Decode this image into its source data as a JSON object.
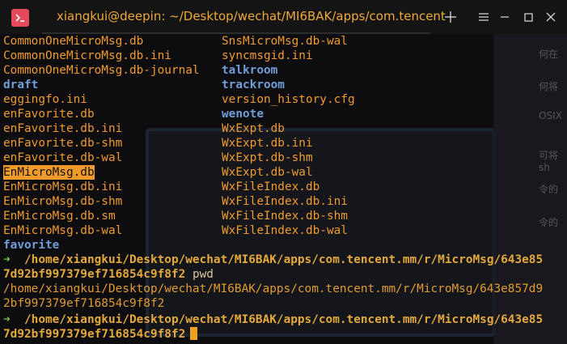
{
  "window": {
    "tab_title": "xiangkui@deepin: ~/Desktop/wechat/MI6BAK/apps/com.tencent"
  },
  "colors": {
    "file": "#f09a2c",
    "directory": "#6f9ed8",
    "prompt_arrow": "#7fbf4a",
    "app_icon": "#e54a5b"
  },
  "listing": {
    "col1": [
      {
        "name": "CommonOneMicroMsg.db",
        "type": "file"
      },
      {
        "name": "CommonOneMicroMsg.db.ini",
        "type": "file"
      },
      {
        "name": "CommonOneMicroMsg.db-journal",
        "type": "file"
      },
      {
        "name": "draft",
        "type": "dir"
      },
      {
        "name": "eggingfo.ini",
        "type": "file"
      },
      {
        "name": "enFavorite.db",
        "type": "file"
      },
      {
        "name": "enFavorite.db.ini",
        "type": "file"
      },
      {
        "name": "enFavorite.db-shm",
        "type": "file"
      },
      {
        "name": "enFavorite.db-wal",
        "type": "file"
      },
      {
        "name": "EnMicroMsg.db",
        "type": "file-highlight"
      },
      {
        "name": "EnMicroMsg.db.ini",
        "type": "file"
      },
      {
        "name": "EnMicroMsg.db-shm",
        "type": "file"
      },
      {
        "name": "EnMicroMsg.db.sm",
        "type": "file"
      },
      {
        "name": "EnMicroMsg.db-wal",
        "type": "file"
      },
      {
        "name": "favorite",
        "type": "dir"
      }
    ],
    "col2": [
      {
        "name": "SnsMicroMsg.db-wal",
        "type": "file"
      },
      {
        "name": "syncmsgid.ini",
        "type": "file"
      },
      {
        "name": "talkroom",
        "type": "dir"
      },
      {
        "name": "trackroom",
        "type": "dir"
      },
      {
        "name": "version_history.cfg",
        "type": "file"
      },
      {
        "name": "wenote",
        "type": "dir"
      },
      {
        "name": "WxExpt.db",
        "type": "file"
      },
      {
        "name": "WxExpt.db.ini",
        "type": "file"
      },
      {
        "name": "WxExpt.db-shm",
        "type": "file"
      },
      {
        "name": "WxExpt.db-wal",
        "type": "file"
      },
      {
        "name": "WxFileIndex.db",
        "type": "file"
      },
      {
        "name": "WxFileIndex.db.ini",
        "type": "file"
      },
      {
        "name": "WxFileIndex.db-shm",
        "type": "file"
      },
      {
        "name": "WxFileIndex.db-wal",
        "type": "file"
      }
    ]
  },
  "session": {
    "prompt_arrow": "➜",
    "prompt1_path_a": "/home/xiangkui/Desktop/wechat/MI6BAK/apps/com.tencent.mm/r/MicroMsg/643e85",
    "prompt1_path_b": "7d92bf997379ef716854c9f8f2",
    "prompt1_cmd": "pwd",
    "output_a": "/home/xiangkui/Desktop/wechat/MI6BAK/apps/com.tencent.mm/r/MicroMsg/643e857d9",
    "output_b": "2bf997379ef716854c9f8f2",
    "prompt2_path_a": "/home/xiangkui/Desktop/wechat/MI6BAK/apps/com.tencent.mm/r/MicroMsg/643e85",
    "prompt2_path_b": "7d92bf997379ef716854c9f8f2"
  },
  "background_text": [
    "何在",
    "何将",
    "OSIX",
    "可将sh",
    "令的",
    "令的"
  ]
}
